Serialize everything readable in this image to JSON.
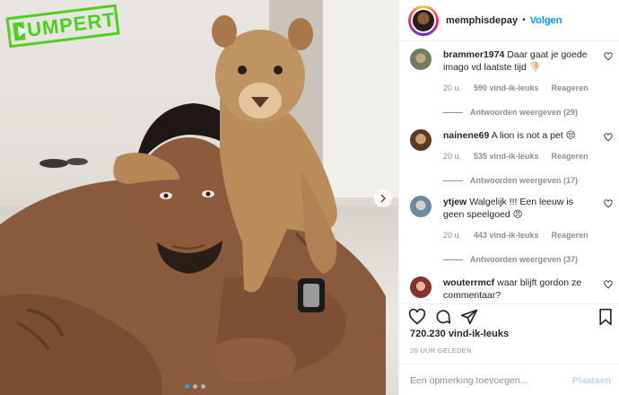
{
  "watermark": {
    "text": "UMPERT",
    "color": "#4cd21e"
  },
  "carousel": {
    "dots": 3,
    "active_index": 0,
    "next_icon": "chevron-right-icon"
  },
  "header": {
    "username": "memphisdepay",
    "separator": "•",
    "follow_label": "Volgen"
  },
  "comments": [
    {
      "username": "brammer1974",
      "text": "Daar gaat je goede imago vd laatste tijd 👎🏻",
      "age": "20 u.",
      "likes": "590 vind-ik-leuks",
      "reply_label": "Reageren",
      "replies": "Antwoorden weergeven (29)"
    },
    {
      "username": "nainene69",
      "text": "A lion is not a pet 😒",
      "age": "20 u.",
      "likes": "535 vind-ik-leuks",
      "reply_label": "Reageren",
      "replies": "Antwoorden weergeven (17)"
    },
    {
      "username": "ytjew",
      "text": "Walgelijk !!! Een leeuw is geen speelgoed 😠",
      "age": "20 u.",
      "likes": "443 vind-ik-leuks",
      "reply_label": "Reageren",
      "replies": "Antwoorden weergeven (37)"
    },
    {
      "username": "wouterrmcf",
      "text": "waar blijft gordon ze commentaar?",
      "age": "",
      "likes": "",
      "reply_label": "",
      "replies": ""
    }
  ],
  "actions": {
    "icons": [
      "heart-icon",
      "comment-icon",
      "share-icon",
      "bookmark-icon"
    ],
    "likes": "720.230 vind-ik-leuks",
    "posted": "20 UUR GELEDEN"
  },
  "add_comment": {
    "placeholder": "Een opmerking toevoegen...",
    "post_label": "Plaatsen"
  },
  "colors": {
    "accent": "#0095f6",
    "muted": "#8e8e8e",
    "post_disabled": "#b3dbff"
  }
}
